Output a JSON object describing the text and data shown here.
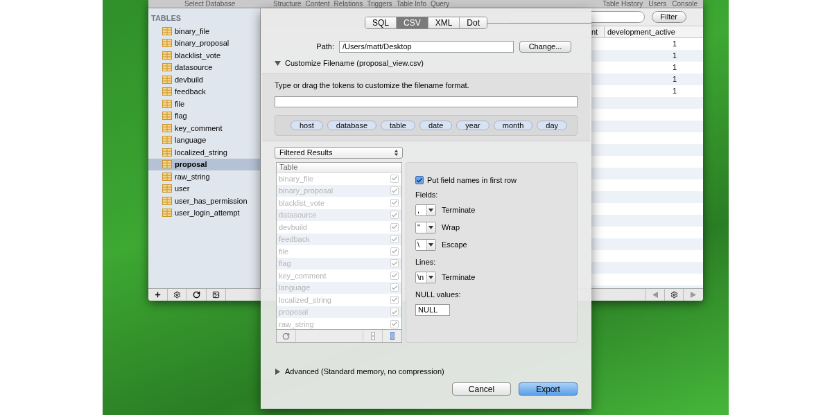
{
  "toolbar": {
    "left": "Select Database",
    "tabs": [
      "Structure",
      "Content",
      "Relations",
      "Triggers",
      "Table Info",
      "Query"
    ],
    "right": [
      "Table History",
      "Users",
      "Console"
    ]
  },
  "sidebar": {
    "heading": "TABLES",
    "items": [
      {
        "label": "binary_file",
        "selected": false
      },
      {
        "label": "binary_proposal",
        "selected": false
      },
      {
        "label": "blacklist_vote",
        "selected": false
      },
      {
        "label": "datasource",
        "selected": false
      },
      {
        "label": "devbuild",
        "selected": false
      },
      {
        "label": "feedback",
        "selected": false
      },
      {
        "label": "file",
        "selected": false
      },
      {
        "label": "flag",
        "selected": false
      },
      {
        "label": "key_comment",
        "selected": false
      },
      {
        "label": "language",
        "selected": false
      },
      {
        "label": "localized_string",
        "selected": false
      },
      {
        "label": "proposal",
        "selected": true
      },
      {
        "label": "raw_string",
        "selected": false
      },
      {
        "label": "user",
        "selected": false
      },
      {
        "label": "user_has_permission",
        "selected": false
      },
      {
        "label": "user_login_attempt",
        "selected": false
      }
    ]
  },
  "content": {
    "filter_button": "Filter",
    "columns": [
      "nt",
      "development_active"
    ],
    "rows": [
      {
        "development_active": "1"
      },
      {
        "development_active": "1"
      },
      {
        "development_active": "1"
      },
      {
        "development_active": "1"
      },
      {
        "development_active": "1"
      }
    ]
  },
  "export_sheet": {
    "formats": [
      {
        "label": "SQL",
        "selected": false
      },
      {
        "label": "CSV",
        "selected": true
      },
      {
        "label": "XML",
        "selected": false
      },
      {
        "label": "Dot",
        "selected": false
      }
    ],
    "path_label": "Path:",
    "path": "/Users/matt/Desktop",
    "change_button": "Change...",
    "customize": {
      "label": "Customize Filename (proposal_view.csv)",
      "expanded": true,
      "hint": "Type or drag the tokens to customize the filename format.",
      "tokens": [
        "host",
        "database",
        "table",
        "date",
        "year",
        "month",
        "day"
      ]
    },
    "source_select": "Filtered Results",
    "table_list": {
      "header": "Table",
      "rows": [
        {
          "label": "binary_file",
          "checked": true
        },
        {
          "label": "binary_proposal",
          "checked": true
        },
        {
          "label": "blacklist_vote",
          "checked": true
        },
        {
          "label": "datasource",
          "checked": true
        },
        {
          "label": "devbuild",
          "checked": true
        },
        {
          "label": "feedback",
          "checked": true
        },
        {
          "label": "file",
          "checked": true
        },
        {
          "label": "flag",
          "checked": true
        },
        {
          "label": "key_comment",
          "checked": true
        },
        {
          "label": "language",
          "checked": true
        },
        {
          "label": "localized_string",
          "checked": true
        },
        {
          "label": "proposal",
          "checked": true
        },
        {
          "label": "raw_string",
          "checked": true
        }
      ]
    },
    "first_row_option": {
      "label": "Put field names in first row",
      "checked": true
    },
    "option_sections": [
      {
        "heading": "Fields:",
        "kind": "combos",
        "combos": [
          {
            "value": ",",
            "label": "Terminate"
          },
          {
            "value": "\"",
            "label": "Wrap"
          },
          {
            "value": "\\",
            "label": "Escape"
          }
        ]
      },
      {
        "heading": "Lines:",
        "kind": "combos",
        "combos": [
          {
            "value": "\\n",
            "label": "Terminate"
          }
        ]
      },
      {
        "heading": "NULL values:",
        "kind": "input",
        "value": "NULL"
      }
    ],
    "advanced": {
      "label": "Advanced (Standard memory, no compression)",
      "expanded": false
    },
    "cancel_button": "Cancel",
    "export_button": "Export"
  }
}
